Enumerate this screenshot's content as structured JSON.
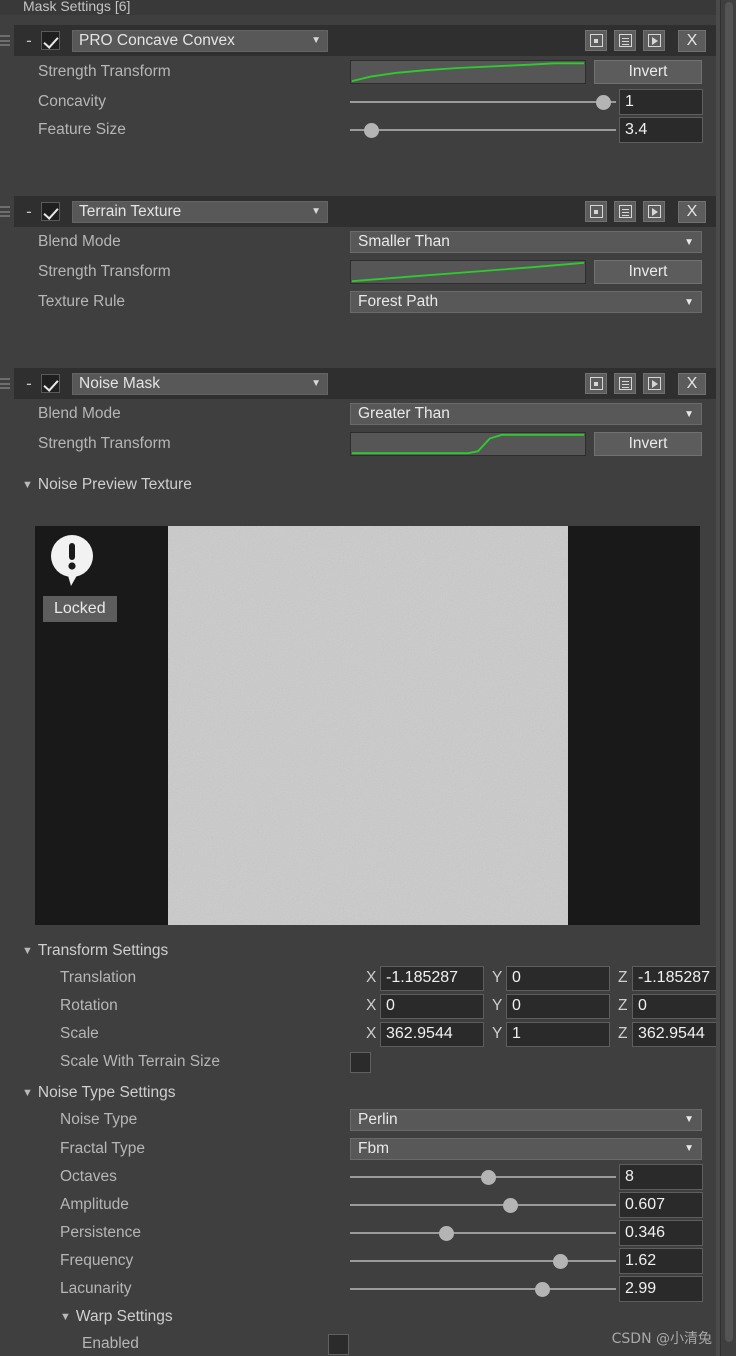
{
  "window": {
    "title": "Mask Settings [6]"
  },
  "modules": [
    {
      "name": "PRO Concave Convex",
      "checked_label": "enabled",
      "tools": {
        "preset_icon": "preset-square-icon",
        "list_icon": "list-icon",
        "play_icon": "play-icon",
        "close_label": "X"
      },
      "rows": [
        {
          "label": "Strength Transform",
          "type": "curve",
          "curve": "ease-out",
          "button": "Invert"
        },
        {
          "label": "Concavity",
          "type": "slider",
          "value": "1",
          "percent": 95
        },
        {
          "label": "Feature Size",
          "type": "slider",
          "value": "3.4",
          "percent": 8
        }
      ]
    },
    {
      "name": "Terrain Texture",
      "tools": {
        "preset_icon": "preset-square-icon",
        "list_icon": "list-icon",
        "play_icon": "play-icon",
        "close_label": "X"
      },
      "rows": [
        {
          "label": "Blend Mode",
          "type": "dropdown",
          "value": "Smaller Than"
        },
        {
          "label": "Strength Transform",
          "type": "curve",
          "curve": "linear",
          "button": "Invert"
        },
        {
          "label": "Texture Rule",
          "type": "dropdown",
          "value": "Forest Path"
        }
      ]
    },
    {
      "name": "Noise Mask",
      "tools": {
        "preset_icon": "preset-square-icon",
        "list_icon": "list-icon",
        "play_icon": "play-icon",
        "close_label": "X"
      },
      "rows": [
        {
          "label": "Blend Mode",
          "type": "dropdown",
          "value": "Greater Than"
        },
        {
          "label": "Strength Transform",
          "type": "curve",
          "curve": "step",
          "button": "Invert"
        }
      ]
    }
  ],
  "noise_preview": {
    "foldout_label": "Noise Preview Texture",
    "locked_label": "Locked",
    "warning_icon": "warning-bubble-icon"
  },
  "transform_settings": {
    "title": "Transform Settings",
    "rows": [
      {
        "label": "Translation",
        "x": "-1.185287",
        "y": "0",
        "z": "-1.185287"
      },
      {
        "label": "Rotation",
        "x": "0",
        "y": "0",
        "z": "0"
      },
      {
        "label": "Scale",
        "x": "362.9544",
        "y": "1",
        "z": "362.9544"
      }
    ],
    "scale_with_terrain": {
      "label": "Scale With Terrain Size",
      "checked": false
    },
    "axis_labels": {
      "x": "X",
      "y": "Y",
      "z": "Z"
    }
  },
  "noise_type_settings": {
    "title": "Noise Type Settings",
    "noise_type": {
      "label": "Noise Type",
      "value": "Perlin"
    },
    "fractal_type": {
      "label": "Fractal Type",
      "value": "Fbm"
    },
    "sliders": [
      {
        "label": "Octaves",
        "value": "8",
        "percent": 52
      },
      {
        "label": "Amplitude",
        "value": "0.607",
        "percent": 60
      },
      {
        "label": "Persistence",
        "value": "0.346",
        "percent": 36
      },
      {
        "label": "Frequency",
        "value": "1.62",
        "percent": 79
      },
      {
        "label": "Lacunarity",
        "value": "2.99",
        "percent": 72
      }
    ],
    "warp_settings": {
      "title": "Warp Settings",
      "enabled_label": "Enabled",
      "enabled": false
    }
  },
  "watermark": {
    "text": "CSDN @小清兔"
  },
  "colors": {
    "panel_bg": "#3f3f3f",
    "header_bg": "#2f2f2f",
    "curve_green": "#2ecb2e",
    "field_bg": "#2a2a2a",
    "control_bg": "#585858",
    "text": "#b6b6b6"
  }
}
